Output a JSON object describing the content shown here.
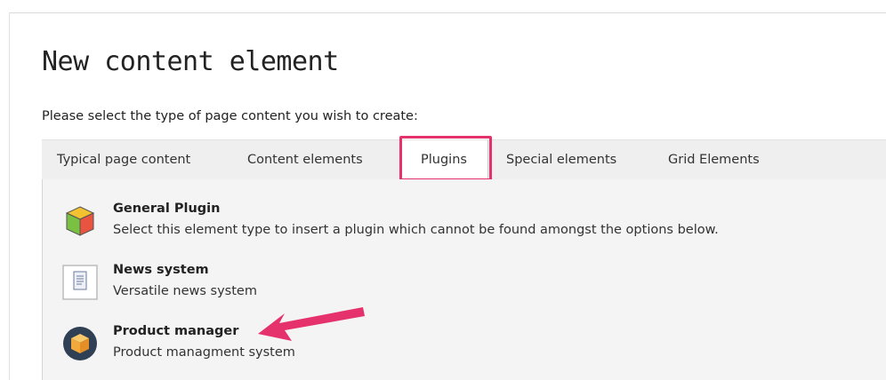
{
  "page": {
    "title": "New content element",
    "subtitle": "Please select the type of page content you wish to create:"
  },
  "tabs": [
    {
      "label": "Typical page content",
      "active": false
    },
    {
      "label": "Content elements",
      "active": false
    },
    {
      "label": "Plugins",
      "active": true
    },
    {
      "label": "Special elements",
      "active": false
    },
    {
      "label": "Grid Elements",
      "active": false
    }
  ],
  "plugins": [
    {
      "name": "General Plugin",
      "description": "Select this element type to insert a plugin which cannot be found amongst the options below.",
      "icon": "cube-icon"
    },
    {
      "name": "News system",
      "description": "Versatile news system",
      "icon": "document-icon"
    },
    {
      "name": "Product manager",
      "description": "Product managment system",
      "icon": "package-icon"
    }
  ],
  "annotations": {
    "highlight_color": "#e5316c",
    "arrow_color": "#e5316c"
  }
}
